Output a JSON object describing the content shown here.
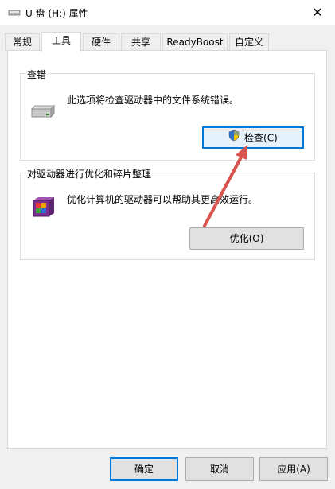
{
  "window": {
    "title": "U 盘 (H:) 属性",
    "close_glyph": "✕"
  },
  "tabs": [
    {
      "label": "常规"
    },
    {
      "label": "工具"
    },
    {
      "label": "硬件"
    },
    {
      "label": "共享"
    },
    {
      "label": "ReadyBoost"
    },
    {
      "label": "自定义"
    }
  ],
  "active_tab": "工具",
  "error_check": {
    "group_title": "查错",
    "description": "此选项将检查驱动器中的文件系统错误。",
    "button_label": "检查(C)",
    "icon": "drive-icon",
    "button_icon": "uac-shield-icon"
  },
  "optimize": {
    "group_title": "对驱动器进行优化和碎片整理",
    "description": "优化计算机的驱动器可以帮助其更高效运行。",
    "button_label": "优化(O)",
    "icon": "defrag-icon"
  },
  "footer": {
    "ok_label": "确定",
    "cancel_label": "取消",
    "apply_label": "应用(A)"
  },
  "annotation": {
    "arrow_color": "#d9534f"
  }
}
